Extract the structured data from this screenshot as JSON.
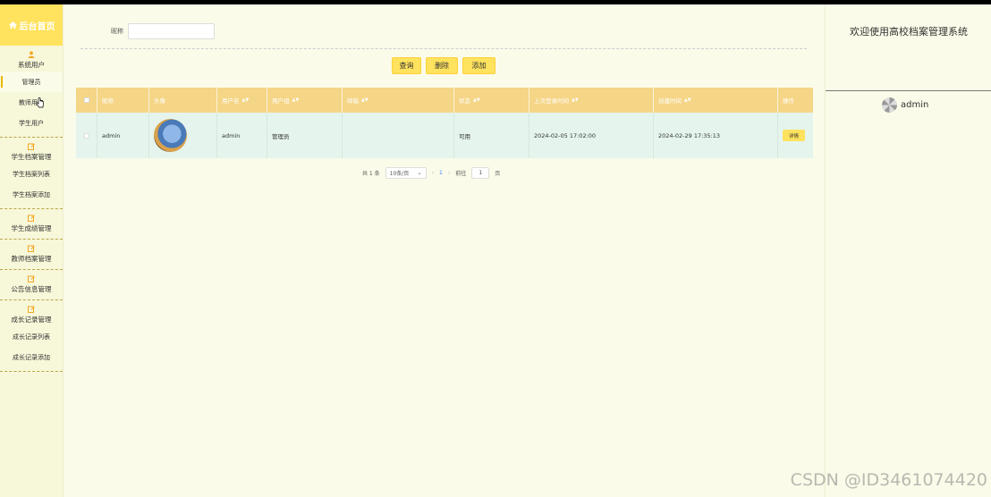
{
  "sidebar": {
    "logo": "后台首页",
    "groups": [
      {
        "title": "系统用户",
        "items": [
          "管理员",
          "教师用户",
          "学生用户"
        ]
      },
      {
        "title": "学生档案管理",
        "items": [
          "学生档案列表",
          "学生档案添加"
        ]
      },
      {
        "title": "学生成绩管理",
        "items": []
      },
      {
        "title": "教师档案管理",
        "items": []
      },
      {
        "title": "公告信息管理",
        "items": []
      },
      {
        "title": "成长记录管理",
        "items": [
          "成长记录列表",
          "成长记录添加"
        ]
      }
    ]
  },
  "search": {
    "label": "昵称",
    "value": ""
  },
  "buttons": {
    "query": "查询",
    "delete": "删除",
    "add": "添加"
  },
  "table": {
    "columns": [
      "昵称",
      "头像",
      "用户名",
      "用户组",
      "邮箱",
      "状态",
      "上次登录时间",
      "创建时间",
      "操作"
    ],
    "rows": [
      {
        "nickname": "admin",
        "username": "admin",
        "group": "管理员",
        "email": "",
        "status": "可用",
        "last_login": "2024-02-05 17:02:00",
        "created": "2024-02-29 17:35:13",
        "action": "详情"
      }
    ]
  },
  "pager": {
    "total": "共 1 条",
    "page_size": "10条/页",
    "page": "1",
    "goto_label": "前往",
    "goto_value": "1",
    "page_unit": "页"
  },
  "right_panel": {
    "title": "欢迎使用高校档案管理系统",
    "user": "admin"
  },
  "watermark": "CSDN @ID3461074420",
  "colors": {
    "accent": "#ffe25d",
    "header": "#f5d586",
    "row": "#e5f5ed",
    "background": "#fbfbe9"
  }
}
